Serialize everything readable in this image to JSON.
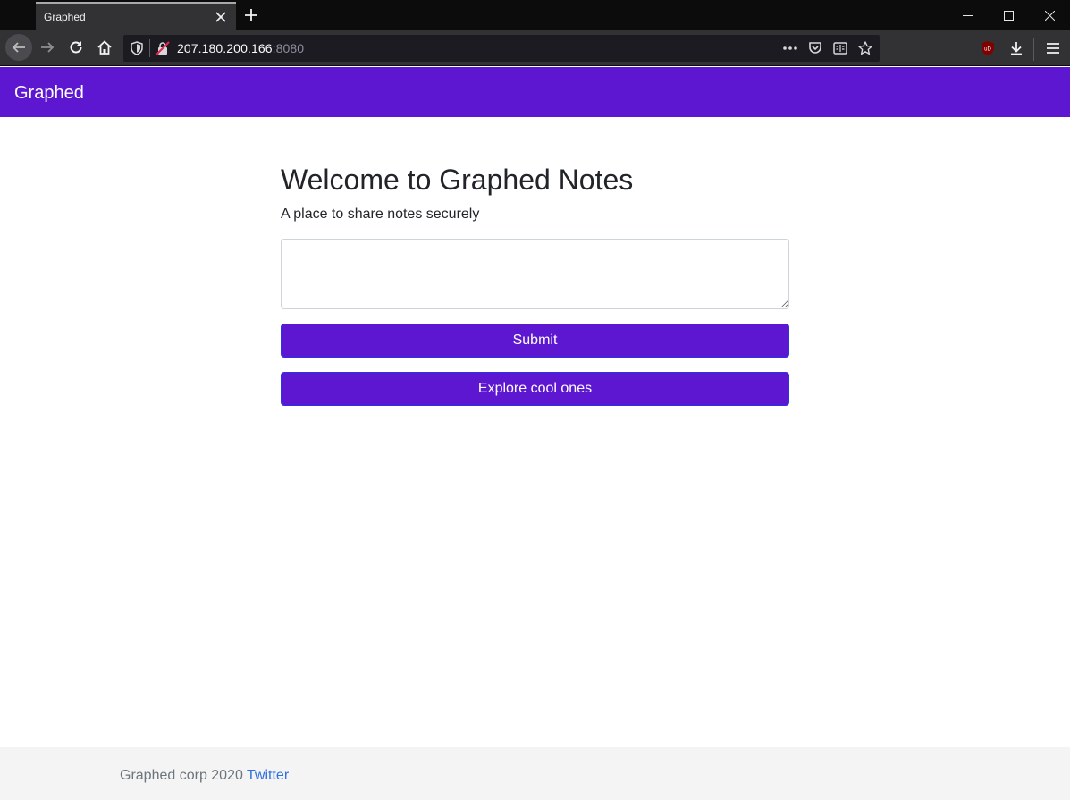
{
  "browser": {
    "tab_title": "Graphed",
    "url_host": "207.180.200.166",
    "url_port": ":8080",
    "icons": {
      "tab_close": "close-icon",
      "new_tab": "plus-icon",
      "minimize": "minimize-icon",
      "maximize": "maximize-icon",
      "close_window": "close-icon",
      "back": "arrow-left-icon",
      "forward": "arrow-right-icon",
      "reload": "reload-icon",
      "home": "home-icon",
      "tracking": "shield-icon",
      "insecure": "insecure-lock-icon",
      "page_actions": "ellipsis-icon",
      "pocket": "pocket-icon",
      "reader": "reader-view-icon",
      "bookmark": "star-icon",
      "ublock": "ublock-icon",
      "downloads": "download-icon",
      "menu": "hamburger-icon"
    }
  },
  "site": {
    "brand": "Graphed",
    "title": "Welcome to Graphed Notes",
    "subtitle": "A place to share notes securely",
    "note_value": "",
    "submit_label": "Submit",
    "explore_label": "Explore cool ones",
    "footer_text": "Graphed corp 2020",
    "footer_link": "Twitter"
  },
  "colors": {
    "accent": "#5e17d1",
    "button_border": "#2b33e8",
    "link": "#2f6fe0",
    "footer_bg": "#f4f4f4"
  }
}
